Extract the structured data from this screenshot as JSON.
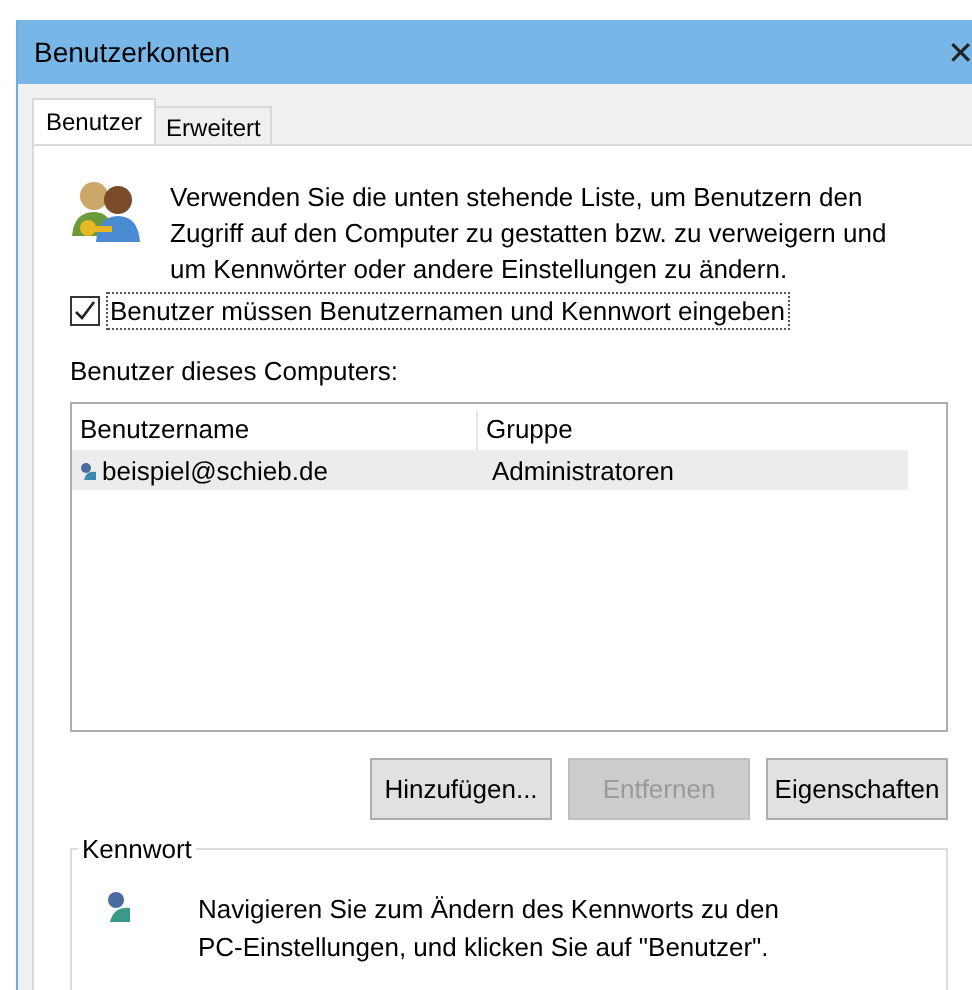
{
  "window": {
    "title": "Benutzerkonten",
    "close": "✕"
  },
  "tabs": [
    {
      "label": "Benutzer",
      "selected": true
    },
    {
      "label": "Erweitert",
      "selected": false
    }
  ],
  "intro": "Verwenden Sie die unten stehende Liste, um Benutzern den Zugriff auf den Computer zu gestatten bzw. zu verweigern und um Kennwörter oder andere Einstellungen zu ändern.",
  "require_login": {
    "label": "Benutzer müssen Benutzernamen und Kennwort eingeben",
    "checked": true
  },
  "users_label": "Benutzer dieses Computers:",
  "table": {
    "columns": [
      "Benutzername",
      "Gruppe"
    ],
    "rows": [
      {
        "cells": [
          "beispiel@schieb.de",
          "Administratoren"
        ],
        "selected": true
      }
    ]
  },
  "buttons": [
    {
      "label": "Hinzufügen...",
      "disabled": false
    },
    {
      "label": "Entfernen",
      "disabled": true
    },
    {
      "label": "Eigenschaften",
      "disabled": false
    }
  ],
  "password": {
    "title": "Kennwort",
    "text": "Navigieren Sie zum Ändern des Kennworts zu den PC-Einstellungen, und klicken Sie auf \"Benutzer\"."
  }
}
